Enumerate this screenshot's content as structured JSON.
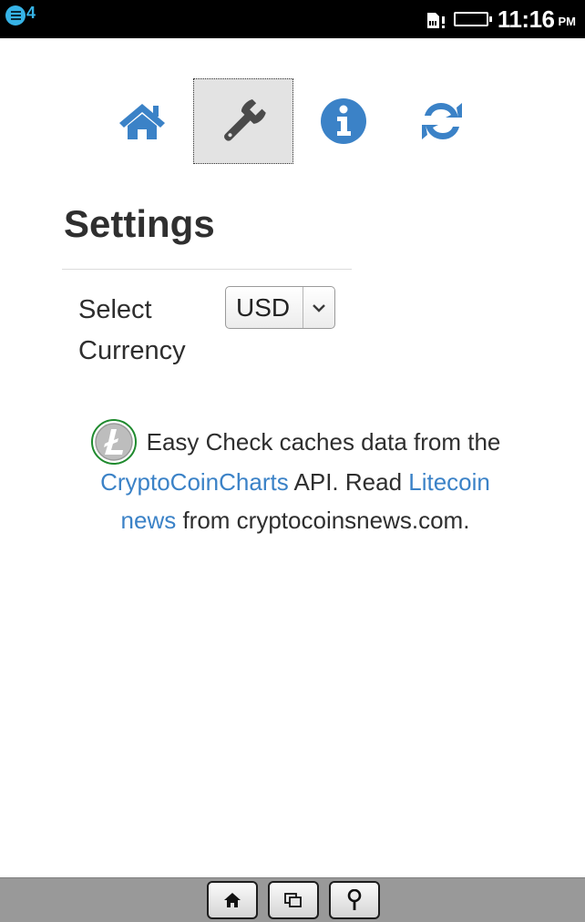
{
  "status_bar": {
    "notification_count": "4",
    "time": "11:16",
    "ampm": "PM"
  },
  "nav": {
    "items": [
      {
        "icon": "home-icon",
        "active": false
      },
      {
        "icon": "wrench-icon",
        "active": true
      },
      {
        "icon": "info-icon",
        "active": false
      },
      {
        "icon": "refresh-icon",
        "active": false
      }
    ],
    "accent_color": "#3b82c7"
  },
  "settings": {
    "title": "Settings",
    "currency_label_line1": "Select",
    "currency_label_line2": "Currency",
    "currency_selected": "USD"
  },
  "info": {
    "text_1": "Easy Check caches data from the",
    "link_1": "CryptoCoinCharts",
    "text_2": " API. Read ",
    "link_2a": "Litecoin",
    "link_2b": "news",
    "text_3": " from cryptocoinsnews.com."
  },
  "bottom_bar": {
    "buttons": [
      "home-icon",
      "recent-apps-icon",
      "location-pin-icon"
    ]
  }
}
